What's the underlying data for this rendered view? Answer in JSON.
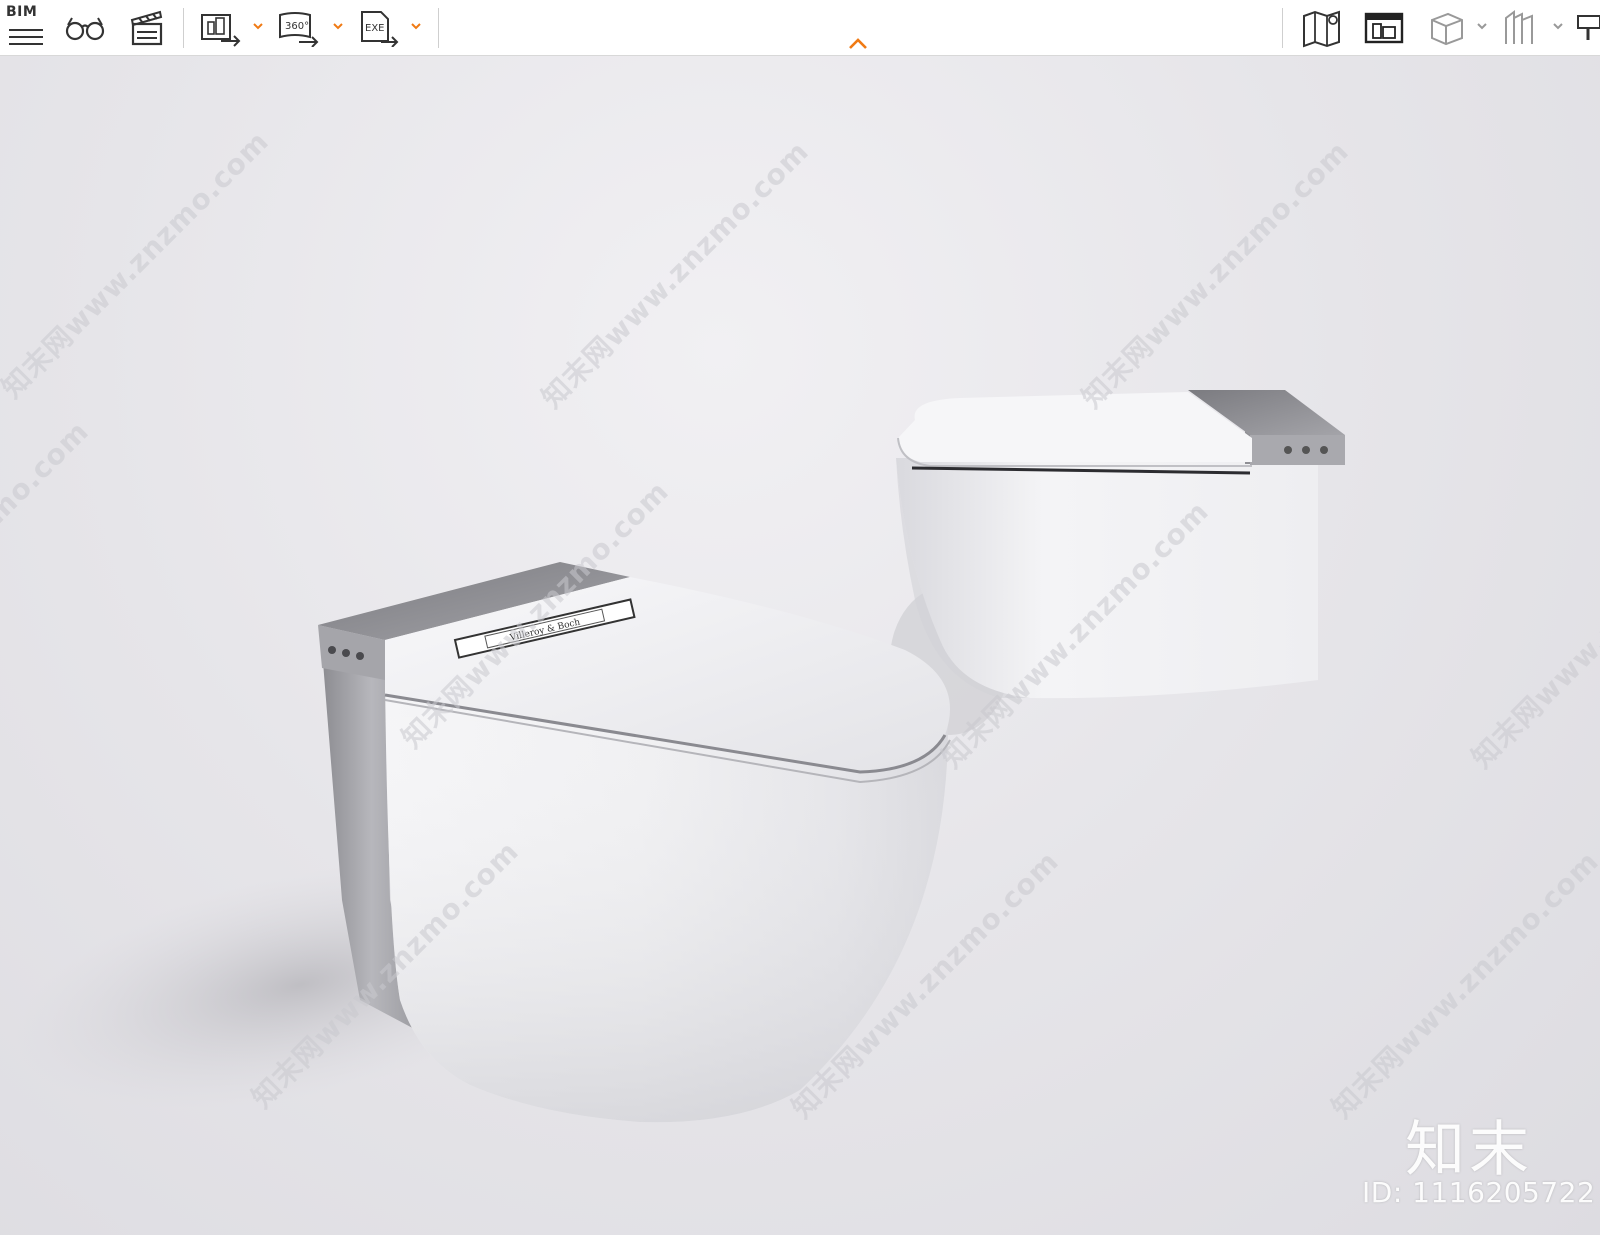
{
  "toolbar": {
    "bim_label": "BIM",
    "left_tools": [
      {
        "icon": "menu-icon"
      },
      {
        "icon": "glasses-icon"
      },
      {
        "icon": "clapperboard-icon"
      },
      {
        "icon": "export-building-icon",
        "has_dropdown": true
      },
      {
        "icon": "export-360-icon",
        "label": "360°",
        "has_dropdown": true
      },
      {
        "icon": "export-exe-icon",
        "label": "EXE",
        "has_dropdown": true
      }
    ],
    "right_tools": [
      {
        "icon": "map-pin-icon"
      },
      {
        "icon": "building-panel-icon"
      },
      {
        "icon": "cube-icon",
        "has_dropdown": true
      },
      {
        "icon": "building-outline-icon",
        "has_dropdown": true
      },
      {
        "icon": "paint-roller-icon"
      }
    ],
    "accent_color": "#f07a14",
    "collapse_icon": "chevron-up-icon"
  },
  "viewport": {
    "watermark_text": "知末网www.znzmo.com",
    "brand_text": "知末",
    "id_text": "ID: 1116205722",
    "product_label": "Villeroy & Boch"
  }
}
